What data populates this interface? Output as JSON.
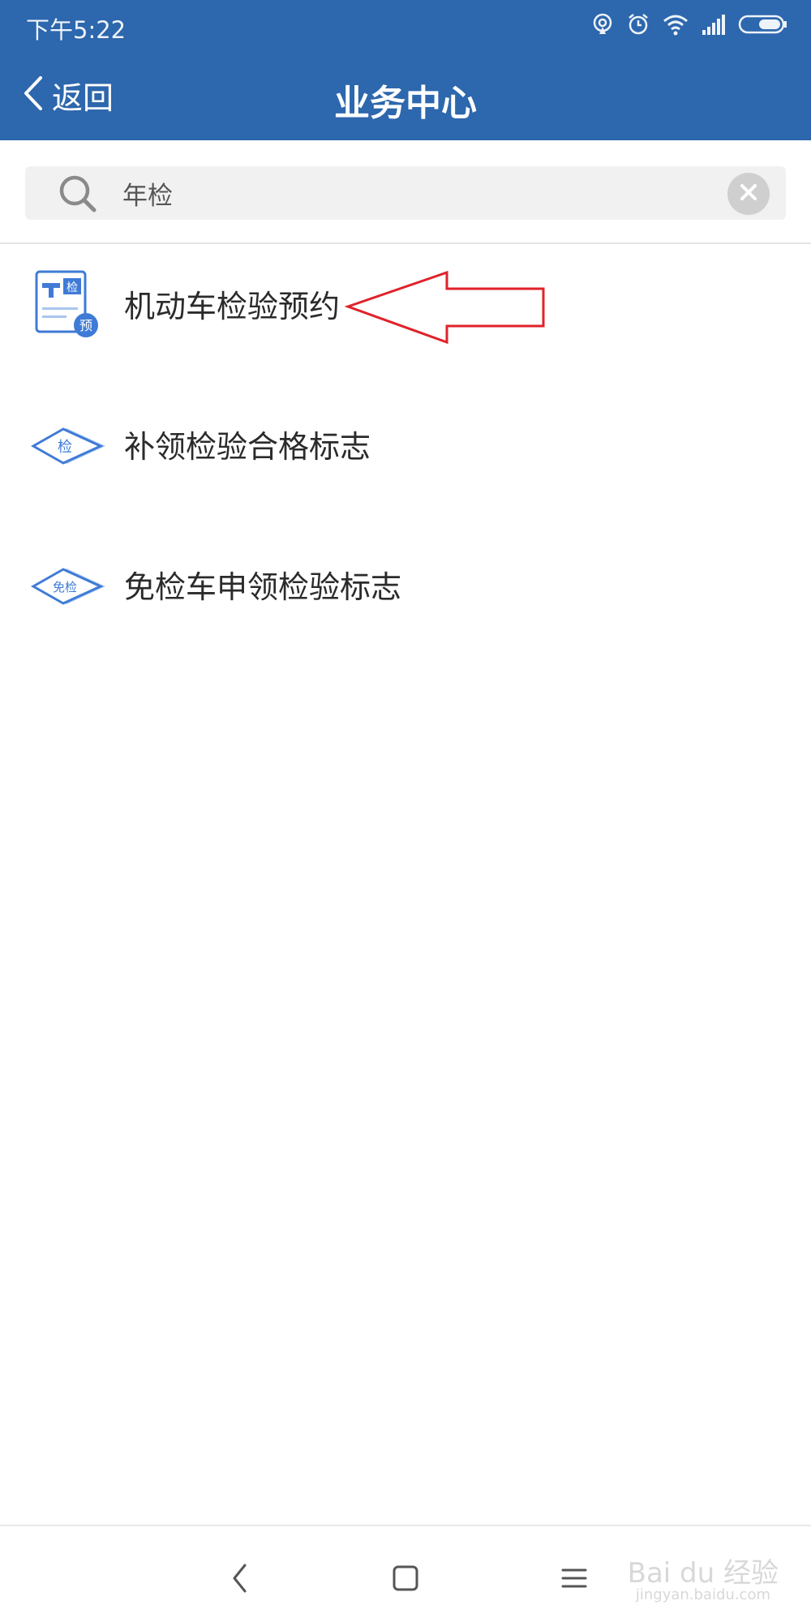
{
  "status_bar": {
    "time": "下午5:22",
    "icons": [
      "hotspot-icon",
      "alarm-icon",
      "wifi-icon",
      "signal-icon",
      "battery-icon"
    ]
  },
  "header": {
    "back_label": "返回",
    "title": "业务中心",
    "background_color": "#2d67ad"
  },
  "search": {
    "value": "年检",
    "icon": "search-icon",
    "clear_icon": "clear-icon"
  },
  "results": [
    {
      "label": "机动车检验预约",
      "icon": "inspection-appointment-icon",
      "icon_text": "检",
      "badge_text": "预"
    },
    {
      "label": "补领检验合格标志",
      "icon": "inspection-label-icon",
      "icon_text": "检"
    },
    {
      "label": "免检车申领检验标志",
      "icon": "exempt-inspection-icon",
      "icon_text": "免检"
    }
  ],
  "annotation": {
    "color": "#e0222a",
    "points_to": "机动车检验预约"
  },
  "bottom_nav": {
    "buttons": [
      "back-nav-icon",
      "home-nav-icon",
      "menu-nav-icon"
    ]
  },
  "watermark": {
    "brand": "Bai du 经验",
    "url": "jingyan.baidu.com"
  }
}
